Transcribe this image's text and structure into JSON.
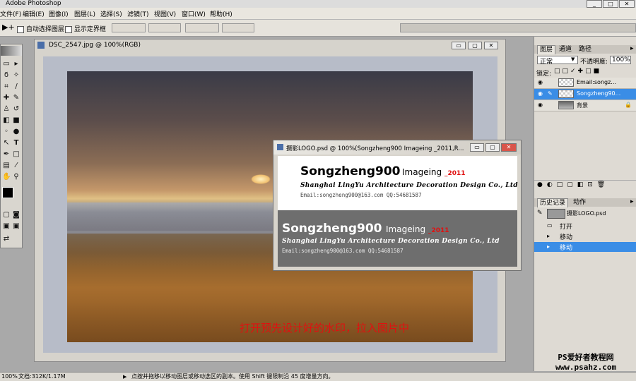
{
  "app": {
    "title": "Adobe Photoshop"
  },
  "menubar": {
    "items": [
      "文件(F)",
      "编辑(E)",
      "图像(I)",
      "图层(L)",
      "选择(S)",
      "滤镜(T)",
      "视图(V)",
      "窗口(W)",
      "帮助(H)"
    ]
  },
  "options": {
    "auto_select": "自动选择图层",
    "show_bounds": "显示定界框"
  },
  "doc": {
    "title": "DSC_2547.jpg @ 100%(RGB)",
    "hint": "打开预先设计好的水印，拉入图片中"
  },
  "logo_window": {
    "title": "摄影LOGO.psd @ 100%(Songzheng900   Imageing _2011,R...",
    "brand": "Songzheng900",
    "imageing": "Imageing",
    "year": "_2011",
    "subtitle": "Shanghai LingYu Architecture Decoration Design Co., Ltd",
    "email": "Email:songzheng900@163.com   QQ:54681587"
  },
  "layers_panel": {
    "tabs": [
      "图层",
      "通道",
      "路径"
    ],
    "blend_mode": "正常",
    "opacity_label": "不透明度:",
    "opacity": "100%",
    "lock_label": "锁定:",
    "layers": [
      {
        "name": "Email:songz...",
        "selected": false
      },
      {
        "name": "Songzheng90...",
        "selected": true
      },
      {
        "name": "背景",
        "selected": false
      }
    ]
  },
  "history_panel": {
    "tabs": [
      "历史记录",
      "动作"
    ],
    "snapshot": "摄影LOGO.psd",
    "items": [
      "打开",
      "移动",
      "移动"
    ]
  },
  "status": {
    "zoom": "100%",
    "doc": "文档:312K/1.17M",
    "tip": "点按并拖移以移动图层或移动选区的副本。使用 Shift 键限制沿 45 度增量方向。"
  },
  "watermark": {
    "line1": "PS爱好者教程网",
    "line2": "www.psahz.com"
  },
  "colors": {
    "selection": "#3a8de6",
    "hint": "#e01010"
  }
}
